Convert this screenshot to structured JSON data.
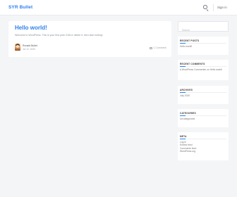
{
  "header": {
    "brand": "SYR Bullet",
    "signin_label": "Sign in"
  },
  "post": {
    "title": "Hello world!",
    "excerpt": "Welcome to WordPress. This is your first post. Edit or delete it, then start writing!",
    "author": "Ronald Bullet",
    "date": "Jul 12, 2020",
    "comments": "1 Comment"
  },
  "sidebar": {
    "search_placeholder": "Search",
    "recent_posts": {
      "title": "RECENT POSTS",
      "items": [
        "Hello world!"
      ]
    },
    "recent_comments": {
      "title": "RECENT COMMENTS",
      "items": [
        "A WordPress Commenter on Hello world!"
      ]
    },
    "archives": {
      "title": "ARCHIVES",
      "items": [
        "July 2020"
      ]
    },
    "categories": {
      "title": "CATEGORIES",
      "items": [
        "Uncategorized"
      ]
    },
    "meta": {
      "title": "META",
      "items": [
        "Log in",
        "Entries feed",
        "Comments feed",
        "WordPress.org"
      ]
    }
  }
}
